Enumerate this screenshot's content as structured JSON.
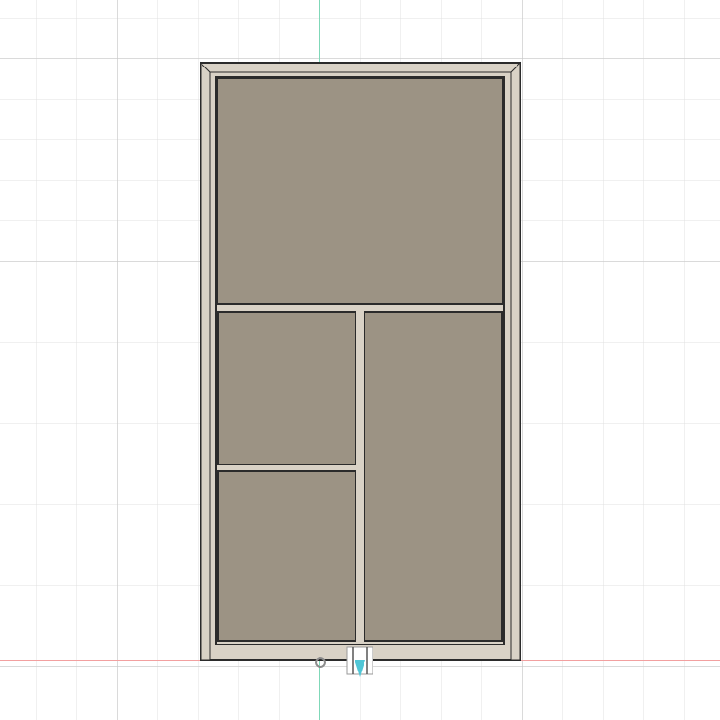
{
  "canvas": {
    "background_color": "#ffffff",
    "grid_major_color": "#c8c8c8",
    "grid_minor_color": "#e1e1e1",
    "axis_vertical_color": "#7fd8b8",
    "axis_horizontal_color": "#f2a0a0"
  },
  "model": {
    "frame_color": "#d9d2c6",
    "frame_outline_color": "#2b2b2b",
    "panel_color": "#9c9384",
    "panels": [
      {
        "name": "top-panel"
      },
      {
        "name": "middle-left-panel"
      },
      {
        "name": "bottom-left-panel"
      },
      {
        "name": "right-tall-panel"
      }
    ]
  },
  "gizmo": {
    "icons": [
      "origin-marker-icon",
      "move-handle-icon",
      "direction-arrow-icon"
    ],
    "arrow_color": "#4fc6d6"
  }
}
